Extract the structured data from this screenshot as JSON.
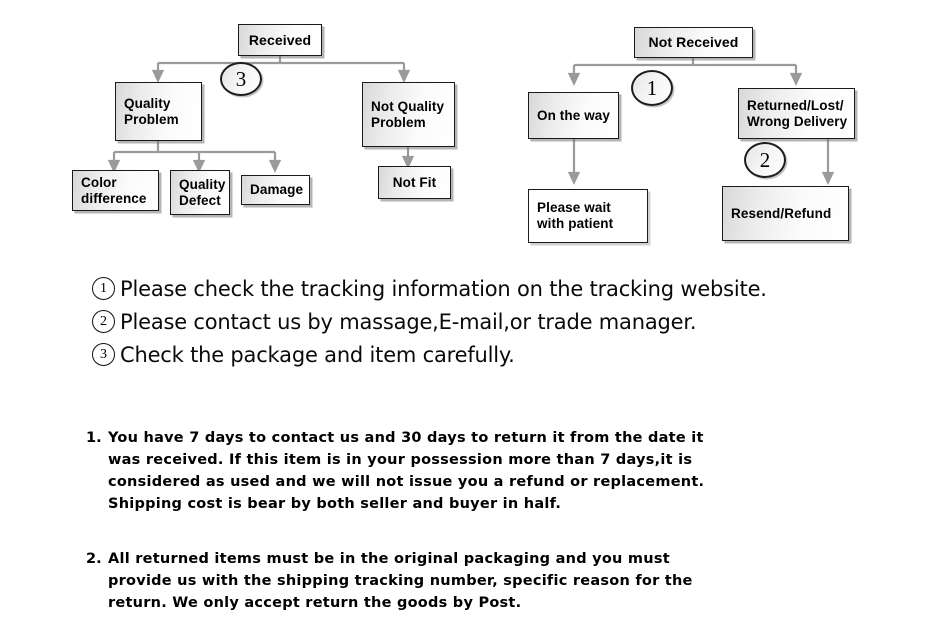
{
  "diagram": {
    "title_hidden": "",
    "left_branch": {
      "root": "Received",
      "step_marker": "3",
      "children": [
        {
          "line1": "Quality",
          "line2": "Problem"
        },
        {
          "line1": "Not Quality",
          "line2": "Problem"
        }
      ],
      "quality_children": [
        {
          "line1": "Color",
          "line2": "difference"
        },
        {
          "line1": "Quality",
          "line2": "Defect"
        },
        {
          "line1": "Damage",
          "line2": ""
        }
      ],
      "not_quality_child": {
        "line1": "Not Fit",
        "line2": ""
      }
    },
    "right_branch": {
      "root": "Not  Received",
      "step_marker_top": "1",
      "step_marker_mid": "2",
      "children": [
        {
          "line1": "On the way",
          "line2": ""
        },
        {
          "line1": "Returned/Lost/",
          "line2": "Wrong Delivery"
        }
      ],
      "on_the_way_child": {
        "line1": "Please wait",
        "line2": "with patient"
      },
      "returned_child": {
        "line1": "Resend/Refund",
        "line2": ""
      }
    },
    "connector_color": "#9a9a9a",
    "box_border_color": "#1a1a1a"
  },
  "legend": {
    "items": [
      {
        "marker": "1",
        "text": "Please check the tracking information on the tracking website."
      },
      {
        "marker": "2",
        "text": "Please contact us by  massage,E-mail,or trade manager."
      },
      {
        "marker": "3",
        "text": "Check the package and item carefully."
      }
    ]
  },
  "terms": [
    {
      "number": "1.",
      "lines": [
        "You have 7 days to contact us and 30 days to return it from the date it",
        "was received. If this item is in your possession more than 7 days,it is",
        "considered as used and we will not issue you a refund or replacement.",
        "Shipping cost is bear by both seller and buyer in half."
      ]
    },
    {
      "number": "2.",
      "lines": [
        "All returned items must be in the original packaging and you must",
        "provide us with the shipping tracking number, specific reason for the",
        "return. We only accept return the goods by Post."
      ]
    }
  ]
}
